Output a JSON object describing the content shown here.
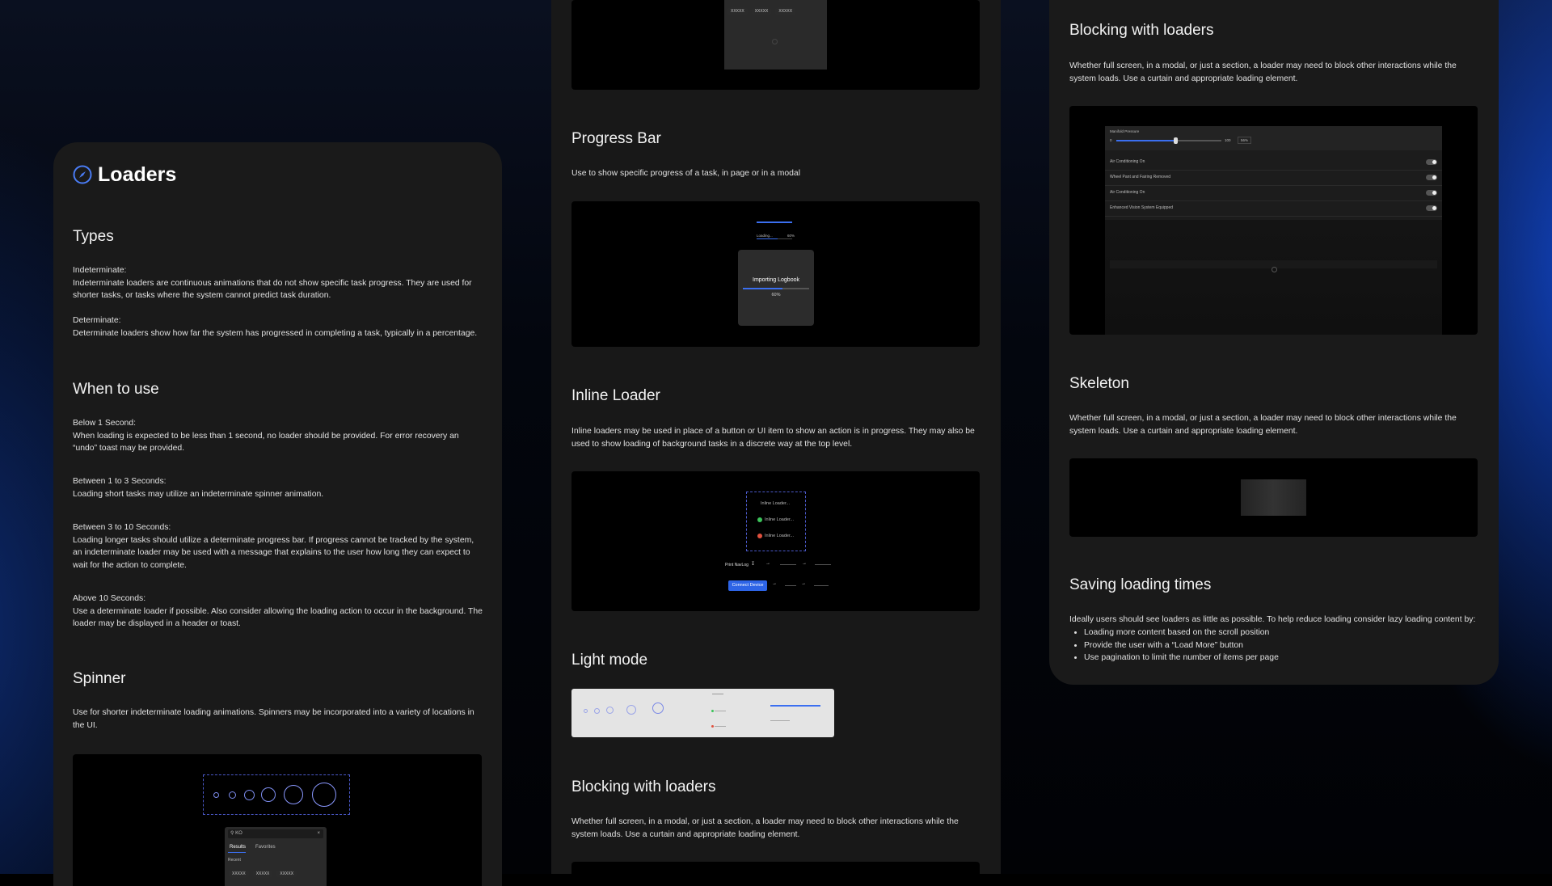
{
  "panel1": {
    "title": "Loaders",
    "types_heading": "Types",
    "indeterminate_label": "Indeterminate:",
    "indeterminate_text": "Indeterminate loaders are continuous animations that do not show specific task progress. They are used for shorter tasks, or tasks where the system cannot predict task duration.",
    "determinate_label": "Determinate:",
    "determinate_text": "Determinate loaders show how far the system has progressed in completing a task, typically in a percentage.",
    "when_heading": "When to use",
    "below1_label": "Below 1 Second:",
    "below1_text": "When loading is expected to be less than 1 second, no loader should be provided. For error recovery an “undo” toast may be provided.",
    "between13_label": "Between 1 to 3 Seconds:",
    "between13_text": "Loading short tasks may utilize an indeterminate spinner animation.",
    "between310_label": "Between 3 to 10 Seconds:",
    "between310_text": "Loading longer tasks should utilize a determinate progress bar. If progress cannot be tracked by the system, an indeterminate loader may be used with a message that explains to the user how long they can expect to wait for the action to complete.",
    "above10_label": "Above 10 Seconds:",
    "above10_text": "Use a determinate loader if possible. Also consider allowing the loading action to occur in the background. The loader may be displayed in a header or toast.",
    "spinner_heading": "Spinner",
    "spinner_text": "Use for shorter indeterminate loading animations. Spinners may be incorporated into a variety of locations in the UI.",
    "demo_search_value": "KO",
    "demo_tab_results": "Results",
    "demo_tab_favorites": "Favorites",
    "demo_recent": "Recent",
    "demo_chip": "XXXXX"
  },
  "panel2": {
    "top_chip": "XXXXX",
    "progress_heading": "Progress Bar",
    "progress_text": "Use to show specific progress of a task, in page or in a modal",
    "progress_small_label": "Loading...",
    "progress_small_pct": "60%",
    "progress_value": 0.6,
    "modal_title": "Importing Logbook",
    "modal_pct": "60%",
    "inline_heading": "Inline Loader",
    "inline_text": "Inline loaders may be used in place of a button or UI item to show an action is in progress. They may also be used to show loading of background tasks in a discrete way at the top level.",
    "inline_item1": "Inline Loader...",
    "inline_item2": "Inline Loader...",
    "inline_item3": "Inline Loader...",
    "print_label": "Print NavLog",
    "connect_label": "Connect Device",
    "light_heading": "Light mode",
    "blocking_heading": "Blocking with loaders",
    "blocking_text": "Whether full screen, in a modal, or just a section, a loader may need to block other interactions while the system loads. Use a curtain and appropriate loading element."
  },
  "panel3": {
    "blocking_heading": "Blocking with loaders",
    "blocking_text": "Whether full screen, in a modal, or just a section, a loader may need to block other interactions while the system loads. Use a curtain and appropriate loading element.",
    "manifold_label": "Manifold Pressure",
    "slider_min": "0",
    "slider_max": "100",
    "slider_value_text": "56%",
    "slider_value": 0.56,
    "toggles": [
      "Air Conditioning On",
      "Wheel Pant and Fairing Removed",
      "Air Conditioning On",
      "Enhanced Vision System Equipped"
    ],
    "skeleton_heading": "Skeleton",
    "skeleton_text": "Whether full screen, in a modal, or just a section, a loader may need to block other interactions while the system loads. Use a curtain and appropriate loading element.",
    "saving_heading": "Saving loading times",
    "saving_text": "Ideally users should see loaders as little as possible. To help reduce loading consider lazy loading content by:",
    "saving_bullets": [
      "Loading more content based on the scroll position",
      "Provide the user with a “Load More” button",
      "Use pagination to limit the number of items per page"
    ]
  },
  "colors": {
    "accent": "#3b6ff0",
    "panel": "#1a1a1a",
    "demo_bg": "#000000"
  }
}
